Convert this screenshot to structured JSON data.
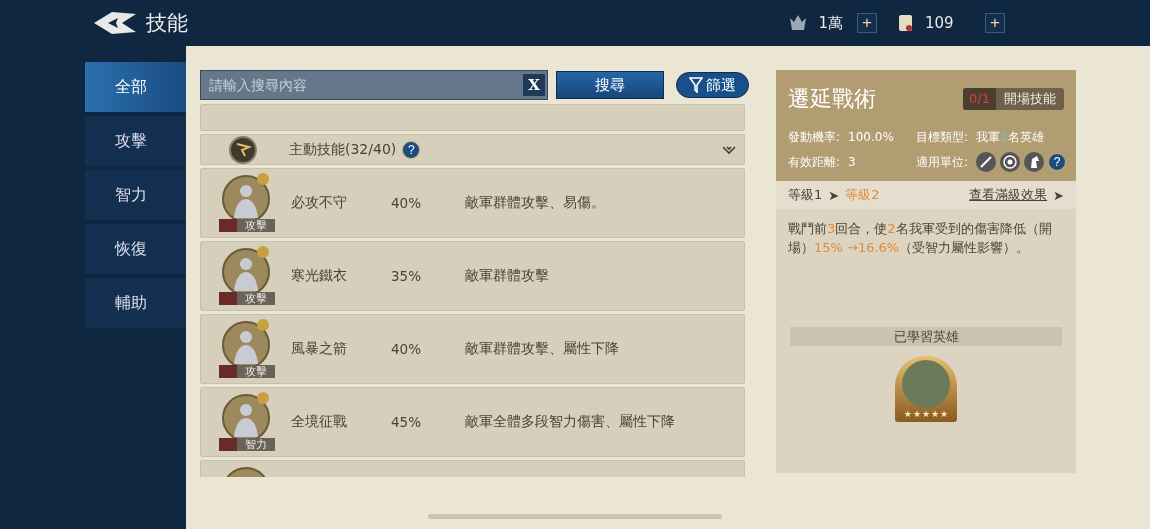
{
  "header": {
    "title": "技能",
    "resources": [
      {
        "kind": "helmet",
        "amount": "1萬",
        "plus": "+"
      },
      {
        "kind": "scroll",
        "amount": "109",
        "plus": "+"
      }
    ]
  },
  "sidebar": {
    "items": [
      {
        "label": "全部",
        "selected": true
      },
      {
        "label": "攻擊",
        "selected": false
      },
      {
        "label": "智力",
        "selected": false
      },
      {
        "label": "恢復",
        "selected": false
      },
      {
        "label": "輔助",
        "selected": false
      }
    ]
  },
  "search": {
    "placeholder": "請輸入搜尋內容",
    "clear": "X",
    "button": "搜尋",
    "filter": "篩選"
  },
  "group": {
    "title": "主動技能(32/40)",
    "help": "?",
    "expanded": true
  },
  "skills": [
    {
      "name": "必攻不守",
      "rate": "40%",
      "effect": "敵軍群體攻擊、易傷。",
      "type": "攻擊",
      "learned": true
    },
    {
      "name": "寒光鐵衣",
      "rate": "35%",
      "effect": "敵軍群體攻擊",
      "type": "攻擊",
      "learned": true
    },
    {
      "name": "風暴之箭",
      "rate": "40%",
      "effect": "敵軍群體攻擊、屬性下降",
      "type": "攻擊",
      "learned": true
    },
    {
      "name": "全境征戰",
      "rate": "45%",
      "effect": "敵軍全體多段智力傷害、屬性下降",
      "type": "智力",
      "learned": true
    },
    {
      "learned": false
    }
  ],
  "detail": {
    "title": "遷延戰術",
    "count": "0/1",
    "tag": "開場技能",
    "stats": [
      {
        "label": "發動機率:",
        "value": [
          {
            "text": "100.0%",
            "highlight": false
          }
        ]
      },
      {
        "label": "目標類型:",
        "value": [
          {
            "text": "我軍",
            "highlight": false
          },
          {
            "text": "2",
            "highlight": true
          },
          {
            "text": "名英雄",
            "highlight": false
          }
        ]
      },
      {
        "label": "有效距離:",
        "value": [
          {
            "text": "3",
            "highlight": false
          }
        ]
      },
      {
        "label": "適用單位:",
        "units": [
          {
            "kind": "sword"
          },
          {
            "kind": "target"
          },
          {
            "kind": "horse"
          }
        ],
        "help": "?"
      }
    ],
    "level_from": "等級1",
    "level_arrow": "➤",
    "level_to": "等級2",
    "max_link": "查看滿級效果",
    "link_arrow": "➤",
    "description": [
      {
        "text": "戰鬥前",
        "highlight": false
      },
      {
        "text": "3",
        "highlight": true
      },
      {
        "text": "回合，使",
        "highlight": false
      },
      {
        "text": "2",
        "highlight": true
      },
      {
        "text": "名我軍受到的傷害降低（開場）",
        "highlight": false
      },
      {
        "text": "15% →16.6%",
        "highlight": true
      },
      {
        "text": "（受智力屬性影響）。",
        "highlight": false
      }
    ],
    "heroes_title": "已學習英雄",
    "heroes": [
      {
        "stars": 5
      }
    ]
  }
}
